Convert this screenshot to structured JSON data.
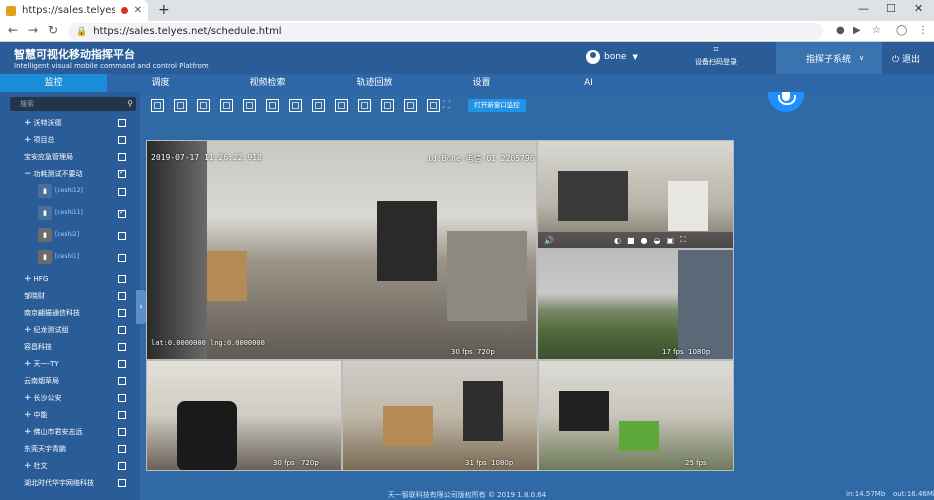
{
  "browser": {
    "tab_title": "https://sales.telyes.net/sch",
    "url": "https://sales.telyes.net/schedule.html",
    "newtab_glyph": "+",
    "icons": [
      "back-icon",
      "forward-icon",
      "reload-icon",
      "lock-icon",
      "camera-icon",
      "video-icon",
      "star-icon",
      "profile-icon",
      "menu-icon"
    ]
  },
  "header": {
    "title_cn": "智慧可视化移动指挥平台",
    "title_en": "Intelligent visual mobile command and control Platfrom",
    "username": "bone",
    "qr_login": "设备扫码登录",
    "command_system": "指挥子系统",
    "logout": "退出"
  },
  "nav": {
    "items": [
      "监控",
      "调度",
      "视频检索",
      "轨迹回放",
      "设置",
      "AI"
    ],
    "active": "监控"
  },
  "sidebar": {
    "search_placeholder": "搜索",
    "tree": [
      {
        "label": "沃特沃德",
        "expander": "+",
        "checked": false
      },
      {
        "label": "项目总",
        "expander": "+",
        "checked": false
      },
      {
        "label": "宝安应急管理局",
        "expander": "",
        "checked": false
      },
      {
        "label": "功耗测试不要动",
        "expander": "−",
        "checked": true
      },
      {
        "label": "[ceshi12]",
        "device": true,
        "online": true,
        "checked": false
      },
      {
        "label": "[ceshi11]",
        "device": true,
        "online": true,
        "checked": true
      },
      {
        "label": "[ceshi2]",
        "device": true,
        "online": false,
        "checked": false
      },
      {
        "label": "[ceshi1]",
        "device": true,
        "online": false,
        "checked": false
      },
      {
        "label": "HFG",
        "expander": "+",
        "checked": false
      },
      {
        "label": "邹晓财",
        "expander": "",
        "checked": false
      },
      {
        "label": "南京翩猫通信科技",
        "expander": "",
        "checked": false
      },
      {
        "label": "纪龙测试组",
        "expander": "+",
        "checked": false
      },
      {
        "label": "容昌科技",
        "expander": "",
        "checked": false
      },
      {
        "label": "天一-TY",
        "expander": "+",
        "checked": false
      },
      {
        "label": "云南烟草局",
        "expander": "",
        "checked": false
      },
      {
        "label": "长沙公安",
        "expander": "+",
        "checked": false
      },
      {
        "label": "中能",
        "expander": "+",
        "checked": false
      },
      {
        "label": "佛山市君安志远",
        "expander": "+",
        "checked": false
      },
      {
        "label": "东莞天宇青鹏",
        "expander": "",
        "checked": false
      },
      {
        "label": "杜文",
        "expander": "+",
        "checked": false
      },
      {
        "label": "湖北时代华宇网络科技",
        "expander": "",
        "checked": false
      }
    ]
  },
  "toolbar": {
    "open_window_label": "打开新窗口监控"
  },
  "cameras": [
    {
      "name": "cam-main",
      "timestamp": "2019-07-17 11:26:22.918",
      "id": "id:Bone-电信-01 2205796",
      "coords": "lat:0.0000000 lng:0.0000000",
      "fps": "30 fps",
      "res": "720p"
    },
    {
      "name": "cam-top-right",
      "timestamp": "",
      "fps": "",
      "res": ""
    },
    {
      "name": "cam-mid-right",
      "fps": "17 fps",
      "res": "1080p"
    },
    {
      "name": "cam-bottom-left",
      "fps": "30 fps",
      "res": "720p"
    },
    {
      "name": "cam-bottom-mid",
      "fps": "31 fps",
      "res": "1080p"
    },
    {
      "name": "cam-bottom-right",
      "fps": "25 fps",
      "res": ""
    }
  ],
  "footer": {
    "copyright": "天一智联科技有限公司版权所有 © 2019 1.8.0.64",
    "in_rate": "in:14.57Mb",
    "out_rate": "out:16.46Mb"
  }
}
